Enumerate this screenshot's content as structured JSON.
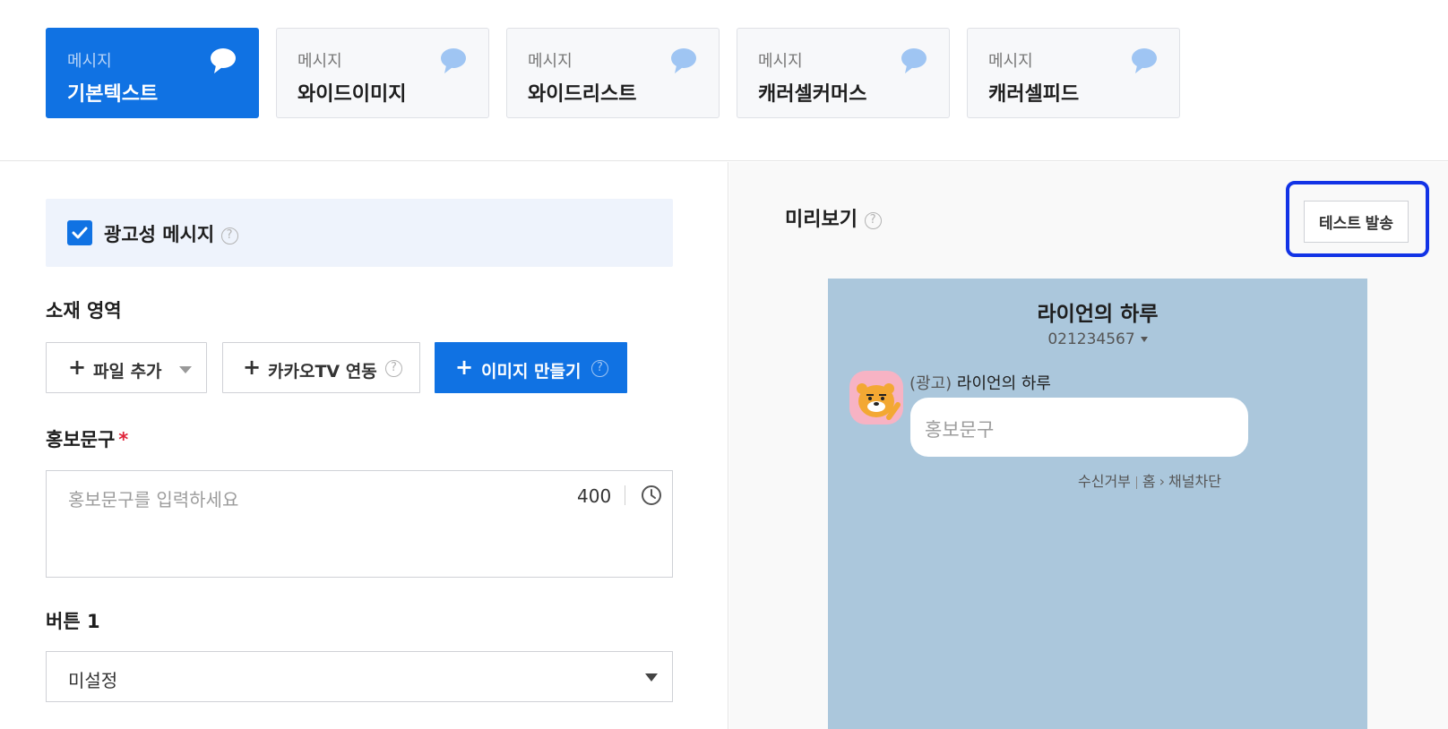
{
  "message_types": [
    {
      "small": "메시지",
      "big": "기본텍스트",
      "active": true
    },
    {
      "small": "메시지",
      "big": "와이드이미지",
      "active": false
    },
    {
      "small": "메시지",
      "big": "와이드리스트",
      "active": false
    },
    {
      "small": "메시지",
      "big": "캐러셀커머스",
      "active": false
    },
    {
      "small": "메시지",
      "big": "캐러셀피드",
      "active": false
    }
  ],
  "form": {
    "ad_message_label": "광고성 메시지",
    "ad_message_checked": true,
    "material_label": "소재 영역",
    "add_file_label": "파일 추가",
    "kakaotv_label": "카카오TV 연동",
    "make_image_label": "이미지 만들기",
    "promo_label": "홍보문구",
    "required_mark": "*",
    "promo_placeholder": "홍보문구를 입력하세요",
    "promo_count": "400",
    "button1_label": "버튼 1",
    "button1_value": "미설정"
  },
  "preview": {
    "title": "미리보기",
    "test_send_label": "테스트 발송",
    "channel_name": "라이언의 하루",
    "channel_number": "021234567",
    "ad_tag": "(광고)",
    "sender_name": "라이언의 하루",
    "bubble_text": "홍보문구",
    "footer_unsubscribe": "수신거부",
    "footer_home": "홈",
    "footer_block": "채널차단"
  },
  "colors": {
    "primary": "#1072e3",
    "focus_ring": "#1233e6",
    "preview_bg": "#abc7dc",
    "required": "#e0243a"
  }
}
